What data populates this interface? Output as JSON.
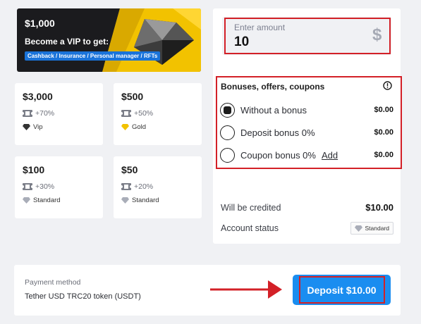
{
  "vip_banner": {
    "amount": "$1,000",
    "title": "Become a VIP to get:",
    "perks": "Cashback / Insurance / Personal manager / RFTs",
    "accent_color": "#f5c400"
  },
  "packages": [
    {
      "amount": "$3,000",
      "bonus": "+70%",
      "tier": "Vip",
      "tier_icon": "black-diamond-icon"
    },
    {
      "amount": "$500",
      "bonus": "+50%",
      "tier": "Gold",
      "tier_icon": "gold-diamond-icon"
    },
    {
      "amount": "$100",
      "bonus": "+30%",
      "tier": "Standard",
      "tier_icon": "silver-diamond-icon"
    },
    {
      "amount": "$50",
      "bonus": "+20%",
      "tier": "Standard",
      "tier_icon": "silver-diamond-icon"
    }
  ],
  "amount_input": {
    "label": "Enter amount",
    "value": "10",
    "currency_symbol": "$"
  },
  "bonuses": {
    "title": "Bonuses, offers, coupons",
    "info_icon": "info-icon",
    "options": [
      {
        "label": "Without a bonus",
        "price": "$0.00",
        "selected": true
      },
      {
        "label": "Deposit bonus 0%",
        "price": "$0.00",
        "selected": false
      },
      {
        "label": "Coupon bonus 0%",
        "price": "$0.00",
        "selected": false,
        "link": "Add"
      }
    ]
  },
  "summary": {
    "credited_label": "Will be credited",
    "credited_value": "$10.00",
    "status_label": "Account status",
    "status_value": "Standard"
  },
  "payment": {
    "method_label": "Payment method",
    "method_value": "Tether USD TRC20 token (USDT)",
    "deposit_button": "Deposit $10.00",
    "button_color": "#1a8df0"
  },
  "annotation_color": "#d32027"
}
